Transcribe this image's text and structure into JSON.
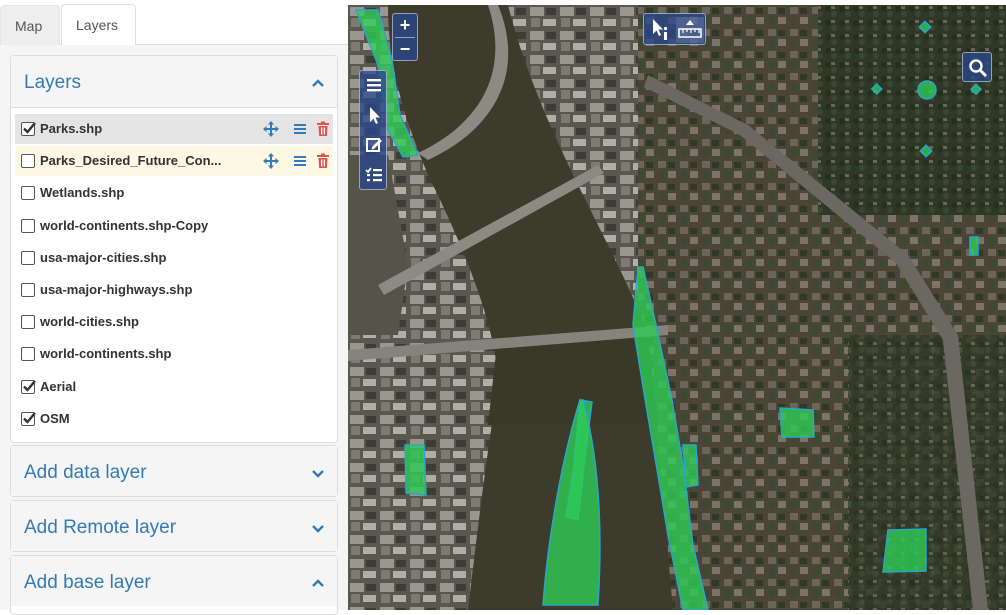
{
  "tabs": [
    {
      "label": "Map",
      "active": false
    },
    {
      "label": "Layers",
      "active": true
    }
  ],
  "layers_panel": {
    "title": "Layers",
    "expanded": true,
    "layers": [
      {
        "name": "Parks.shp",
        "checked": true,
        "state": "selected"
      },
      {
        "name": "Parks_Desired_Future_Con...",
        "checked": false,
        "state": "hover"
      },
      {
        "name": "Wetlands.shp",
        "checked": false
      },
      {
        "name": "world-continents.shp-Copy",
        "checked": false
      },
      {
        "name": "usa-major-cities.shp",
        "checked": false
      },
      {
        "name": "usa-major-highways.shp",
        "checked": false
      },
      {
        "name": "world-cities.shp",
        "checked": false
      },
      {
        "name": "world-continents.shp",
        "checked": false
      },
      {
        "name": "Aerial",
        "checked": true
      },
      {
        "name": "OSM",
        "checked": true
      }
    ]
  },
  "add_data_panel": {
    "title": "Add data layer",
    "expanded": false
  },
  "add_remote_panel": {
    "title": "Add Remote layer",
    "expanded": false
  },
  "add_base_panel": {
    "title": "Add base layer",
    "expanded": true
  },
  "map": {
    "zoom_in_label": "+",
    "zoom_out_label": "−",
    "tools": [
      "layer-list-icon",
      "select-icon",
      "edit-icon",
      "attribute-list-icon"
    ],
    "top_tools": [
      "identify-icon",
      "measure-icon"
    ],
    "search_icon": "search-icon"
  },
  "colors": {
    "accent": "#337ab7",
    "park_fill": "#2ecc55",
    "park_stroke": "#2aa6c8",
    "delete": "#d9534f",
    "map_control": "#2c4f9a"
  }
}
